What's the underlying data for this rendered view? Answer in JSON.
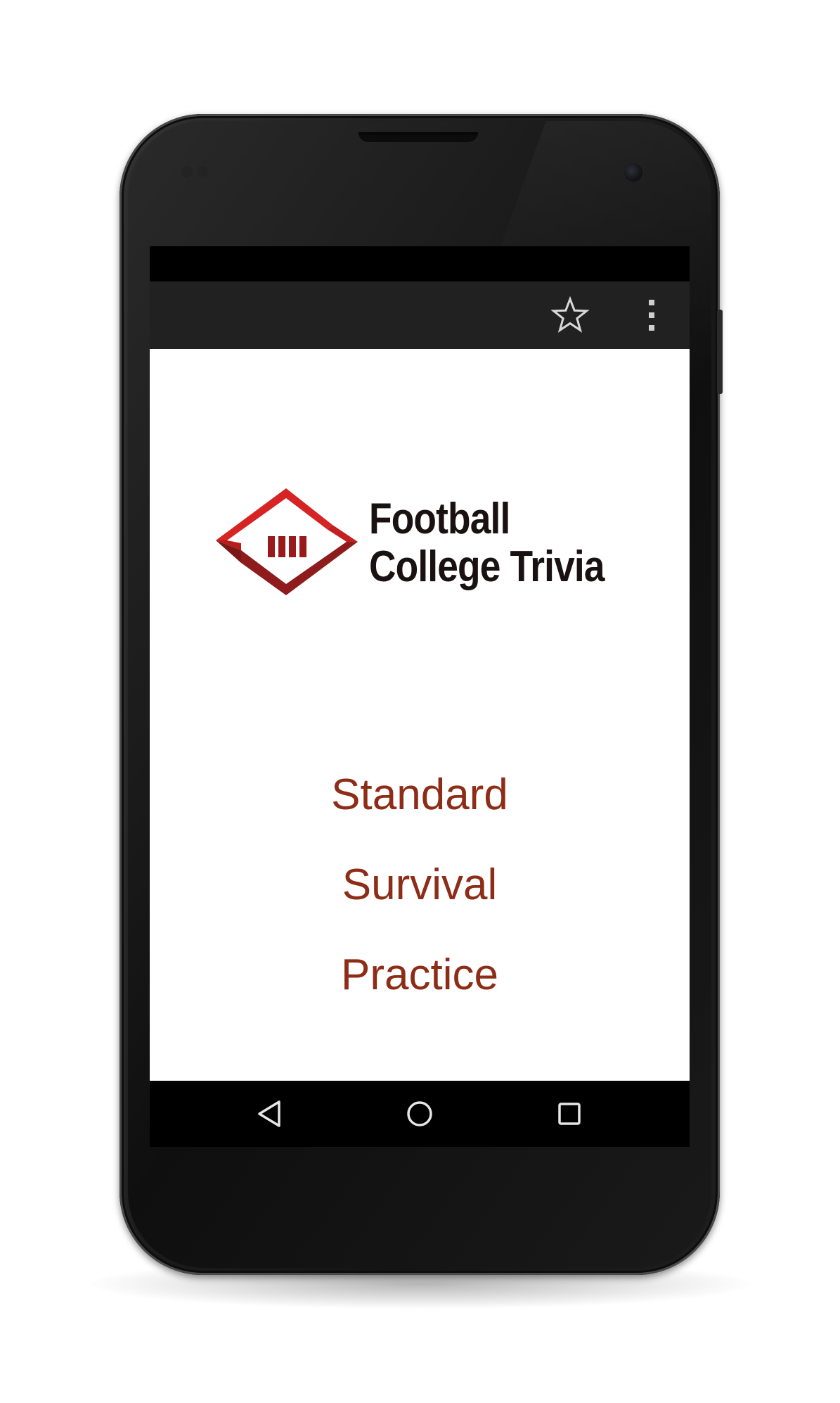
{
  "app": {
    "title_line1": "Football",
    "title_line2": "College Trivia",
    "logo_icon": "football-stadium-logo-icon",
    "accent_color": "#8e2d17",
    "logo_red": "#d62424",
    "logo_dark_red": "#8e1c1c"
  },
  "action_bar": {
    "icons": [
      "star-outline-icon",
      "overflow-menu-icon"
    ]
  },
  "menu": {
    "items": [
      {
        "label": "Standard"
      },
      {
        "label": "Survival"
      },
      {
        "label": "Practice"
      }
    ]
  },
  "nav_bar": {
    "icons": [
      "back-triangle-icon",
      "home-circle-icon",
      "recents-square-icon"
    ]
  }
}
